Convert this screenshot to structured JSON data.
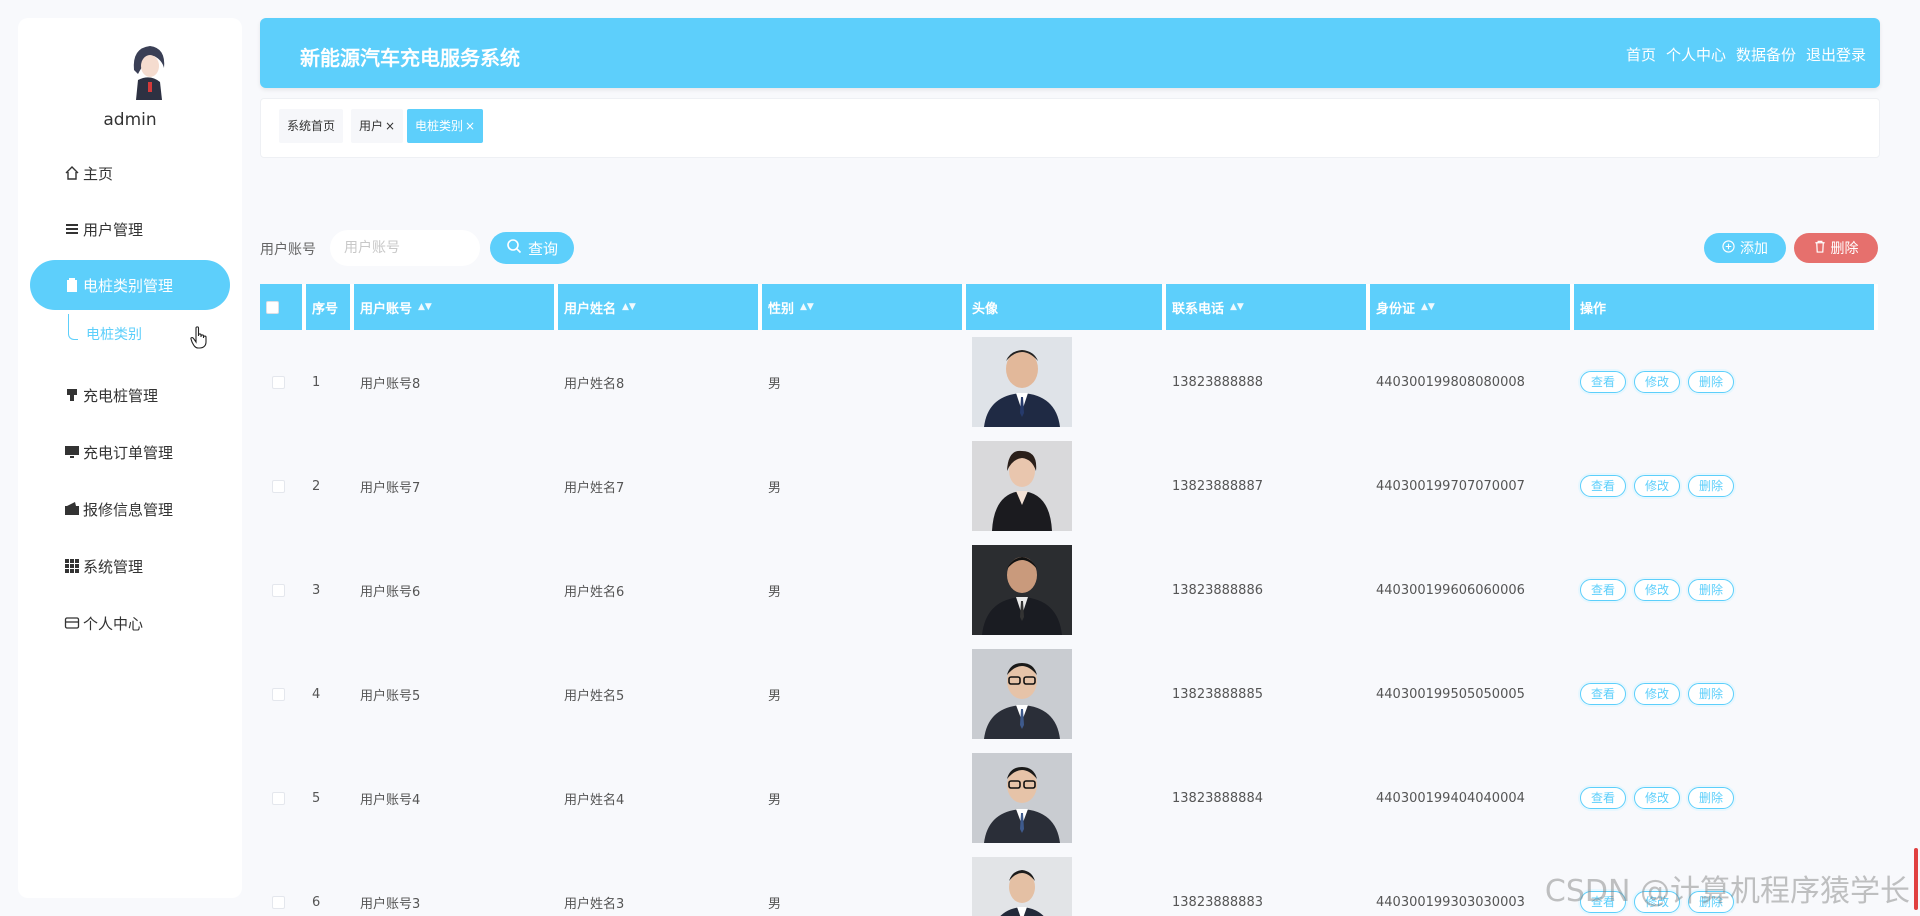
{
  "user": {
    "name": "admin"
  },
  "header": {
    "title": "新能源汽车充电服务系统",
    "nav": [
      "首页",
      "个人中心",
      "数据备份",
      "退出登录"
    ]
  },
  "sidebar": {
    "items": [
      {
        "label": "主页",
        "icon": "home-icon"
      },
      {
        "label": "用户管理",
        "icon": "list-icon"
      },
      {
        "label": "电桩类别管理",
        "icon": "clipboard-icon",
        "active": true
      },
      {
        "label": "充电桩管理",
        "icon": "charger-icon"
      },
      {
        "label": "充电订单管理",
        "icon": "monitor-icon"
      },
      {
        "label": "报修信息管理",
        "icon": "wallet-icon"
      },
      {
        "label": "系统管理",
        "icon": "grid-icon"
      },
      {
        "label": "个人中心",
        "icon": "card-icon"
      }
    ],
    "sub_item": "电桩类别"
  },
  "tabs": {
    "home": "系统首页",
    "user": "用户",
    "active": "电桩类别",
    "close": "×"
  },
  "search": {
    "label": "用户账号",
    "placeholder": "用户账号",
    "query_button": "查询"
  },
  "actions": {
    "add": "添加",
    "delete": "删除"
  },
  "table": {
    "columns": [
      "序号",
      "用户账号",
      "用户姓名",
      "性别",
      "头像",
      "联系电话",
      "身份证",
      "操作"
    ],
    "rows": [
      {
        "index": "1",
        "account": "用户账号8",
        "name": "用户姓名8",
        "gender": "男",
        "phone": "13823888888",
        "id_card": "440300199808080008"
      },
      {
        "index": "2",
        "account": "用户账号7",
        "name": "用户姓名7",
        "gender": "男",
        "phone": "13823888887",
        "id_card": "440300199707070007"
      },
      {
        "index": "3",
        "account": "用户账号6",
        "name": "用户姓名6",
        "gender": "男",
        "phone": "13823888886",
        "id_card": "440300199606060006"
      },
      {
        "index": "4",
        "account": "用户账号5",
        "name": "用户姓名5",
        "gender": "男",
        "phone": "13823888885",
        "id_card": "440300199505050005"
      },
      {
        "index": "5",
        "account": "用户账号4",
        "name": "用户姓名4",
        "gender": "男",
        "phone": "13823888884",
        "id_card": "440300199404040004"
      },
      {
        "index": "6",
        "account": "用户账号3",
        "name": "用户姓名3",
        "gender": "男",
        "phone": "13823888883",
        "id_card": "440300199303030003"
      }
    ],
    "row_actions": [
      "查看",
      "修改",
      "删除"
    ]
  },
  "watermark": "CSDN @计算机程序猿学长",
  "colors": {
    "primary": "#5dcffb",
    "danger": "#e6706d",
    "background": "#f8f9fc"
  }
}
